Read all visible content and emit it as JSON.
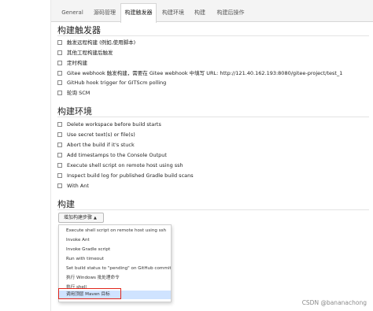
{
  "tabs": [
    "General",
    "源码管理",
    "构建触发器",
    "构建环境",
    "构建",
    "构建后操作"
  ],
  "active_tab": "构建触发器",
  "sections": {
    "triggers": {
      "title": "构建触发器",
      "items": [
        "触发远程构建 (例如,使用脚本)",
        "其他工程构建后触发",
        "定时构建",
        "Gitee webhook 触发构建，需要在 Gitee webhook 中填写 URL: http://121.40.162.193:8080/gitee-project/test_1",
        "GitHub hook trigger for GITScm polling",
        "轮询 SCM"
      ]
    },
    "environment": {
      "title": "构建环境",
      "items": [
        "Delete workspace before build starts",
        "Use secret text(s) or file(s)",
        "Abort the build if it's stuck",
        "Add timestamps to the Console Output",
        "Execute shell script on remote host using ssh",
        "Inspect build log for published Gradle build scans",
        "With Ant"
      ]
    },
    "build": {
      "title": "构建",
      "add_step_label": "增加构建步骤",
      "caret": "▲"
    }
  },
  "dropdown": {
    "items": [
      "Execute shell script on remote host using ssh",
      "Invoke Ant",
      "Invoke Gradle script",
      "Run with timeout",
      "Set build status to \"pending\" on GitHub commit",
      "执行 Windows 批处理命令",
      "执行 shell",
      "调用顶层 Maven 目标"
    ],
    "highlighted": "调用顶层 Maven 目标"
  },
  "watermark": "CSDN @bananachong",
  "colors": {
    "highlight": "#cfe3ff",
    "callout_border": "#e1251b"
  }
}
